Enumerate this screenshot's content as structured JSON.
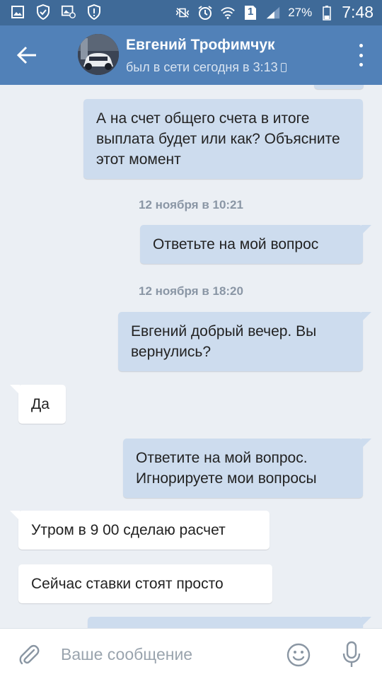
{
  "statusbar": {
    "battery_percent": "27%",
    "time": "7:48",
    "sim_label": "1"
  },
  "header": {
    "contact_name": "Евгений Трофимчук",
    "last_seen": "был в сети сегодня в 3:13"
  },
  "messages": [
    {
      "direction": "outgoing",
      "text": "А на счет общего счета в итоге выплата будет или как? Объясните этот момент"
    },
    {
      "type": "date",
      "text": "12 ноября в 10:21"
    },
    {
      "direction": "outgoing",
      "text": "Ответьте на мой вопрос"
    },
    {
      "type": "date",
      "text": "12 ноября в 18:20"
    },
    {
      "direction": "outgoing",
      "text": "Евгений добрый вечер. Вы вернулись?"
    },
    {
      "direction": "incoming",
      "text": "Да"
    },
    {
      "direction": "outgoing",
      "text": "Ответите на мой вопрос. Игнорируете мои вопросы"
    },
    {
      "direction": "incoming",
      "text": "Утром в 9 00 сделаю расчет"
    },
    {
      "direction": "incoming",
      "text": "Сейчас ставки стоят просто"
    }
  ],
  "composer": {
    "placeholder": "Ваше сообщение"
  },
  "colors": {
    "header_bg": "#5181b8",
    "statusbar_bg": "#3f6a98",
    "chat_bg": "#ebeff4",
    "outgoing_bubble": "#cddcee",
    "incoming_bubble": "#ffffff"
  },
  "icons": {
    "back": "arrow-left-icon",
    "menu": "more-vertical-icon",
    "attach": "paperclip-icon",
    "emoji": "smiley-icon",
    "mic": "microphone-icon"
  }
}
